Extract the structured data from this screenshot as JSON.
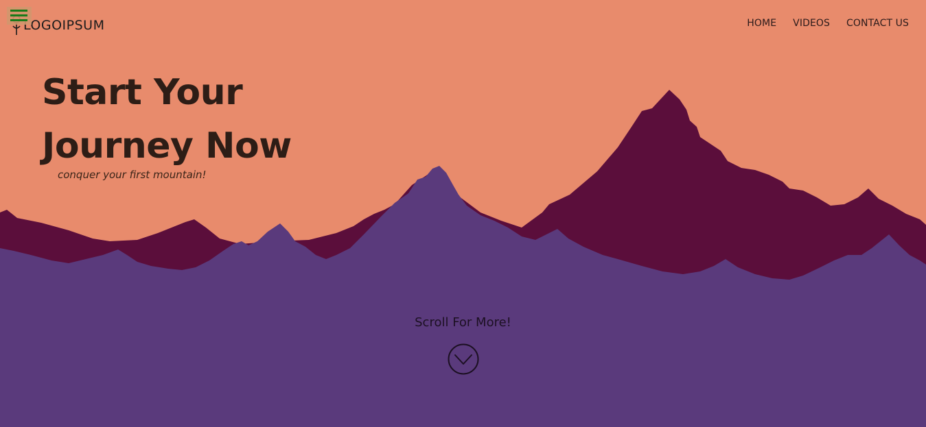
{
  "brand": {
    "logo_text": "LOGOIPSUM",
    "logo_icon": "tree-pin-icon",
    "menu_icon": "hamburger-menu-icon"
  },
  "nav": {
    "items": [
      {
        "label": "HOME"
      },
      {
        "label": "VIDEOS"
      },
      {
        "label": "CONTACT US"
      }
    ]
  },
  "hero": {
    "title_line1": "Start Your",
    "title_line2": "Journey Now",
    "subtitle": "conquer your first mountain!"
  },
  "scroll": {
    "label": "Scroll For More!",
    "icon": "chevron-down-circle-icon"
  },
  "colors": {
    "sky": "#e88b6c",
    "back_mountains": "#5b0e3b",
    "front_mountains": "#5a3a7c",
    "text_dark": "#2d1d16",
    "menu_icon": "#1a7a1a"
  }
}
